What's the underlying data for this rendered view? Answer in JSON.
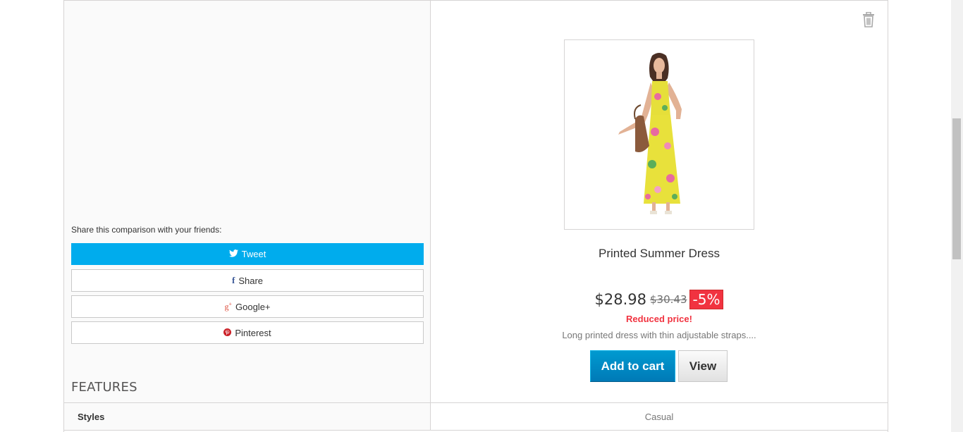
{
  "share": {
    "label": "Share this comparison with your friends:",
    "tweet": "Tweet",
    "facebook": "Share",
    "googleplus": "Google+",
    "pinterest": "Pinterest",
    "icons": {
      "tweet": "twitter-icon",
      "facebook": "facebook-icon",
      "googleplus": "google-plus-icon",
      "pinterest": "pinterest-icon"
    },
    "tweet_color": "#00aced"
  },
  "features": {
    "title": "FEATURES",
    "rows": [
      {
        "name": "Styles",
        "value": "Casual"
      }
    ]
  },
  "product": {
    "name": "Printed Summer Dress",
    "price": "$28.98",
    "old_price": "$30.43",
    "discount": "-5%",
    "reduced_label": "Reduced price!",
    "description": "Long printed dress with thin adjustable straps....",
    "add_to_cart": "Add to cart",
    "view": "View",
    "remove_icon": "trash-icon",
    "discount_color": "#f13340",
    "cart_color": "#009ad0"
  }
}
